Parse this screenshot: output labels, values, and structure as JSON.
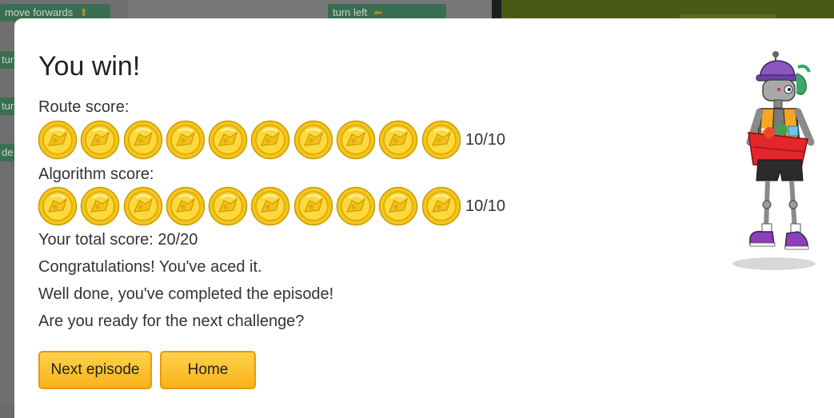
{
  "background": {
    "blocks": [
      {
        "label": "move forwards",
        "icon": "arrow-up-icon"
      },
      {
        "label": "turn left",
        "icon": "arrow-left-icon"
      },
      {
        "label": "tur"
      },
      {
        "label": "tur"
      },
      {
        "label": "de"
      }
    ]
  },
  "dialog": {
    "title": "You win!",
    "route_score_label": "Route score:",
    "route_score": "10/10",
    "route_coins": 10,
    "algorithm_score_label": "Algorithm score:",
    "algorithm_score": "10/10",
    "algorithm_coins": 10,
    "total_score": "Your total score: 20/20",
    "messages": [
      "Congratulations! You've aced it.",
      "Well done, you've completed the episode!",
      "Are you ready for the next challenge?"
    ],
    "buttons": {
      "next_episode": "Next episode",
      "home": "Home"
    }
  },
  "colors": {
    "coin_gold": "#f5c518",
    "button_gold": "#ffc42e",
    "button_border": "#e89a10"
  }
}
